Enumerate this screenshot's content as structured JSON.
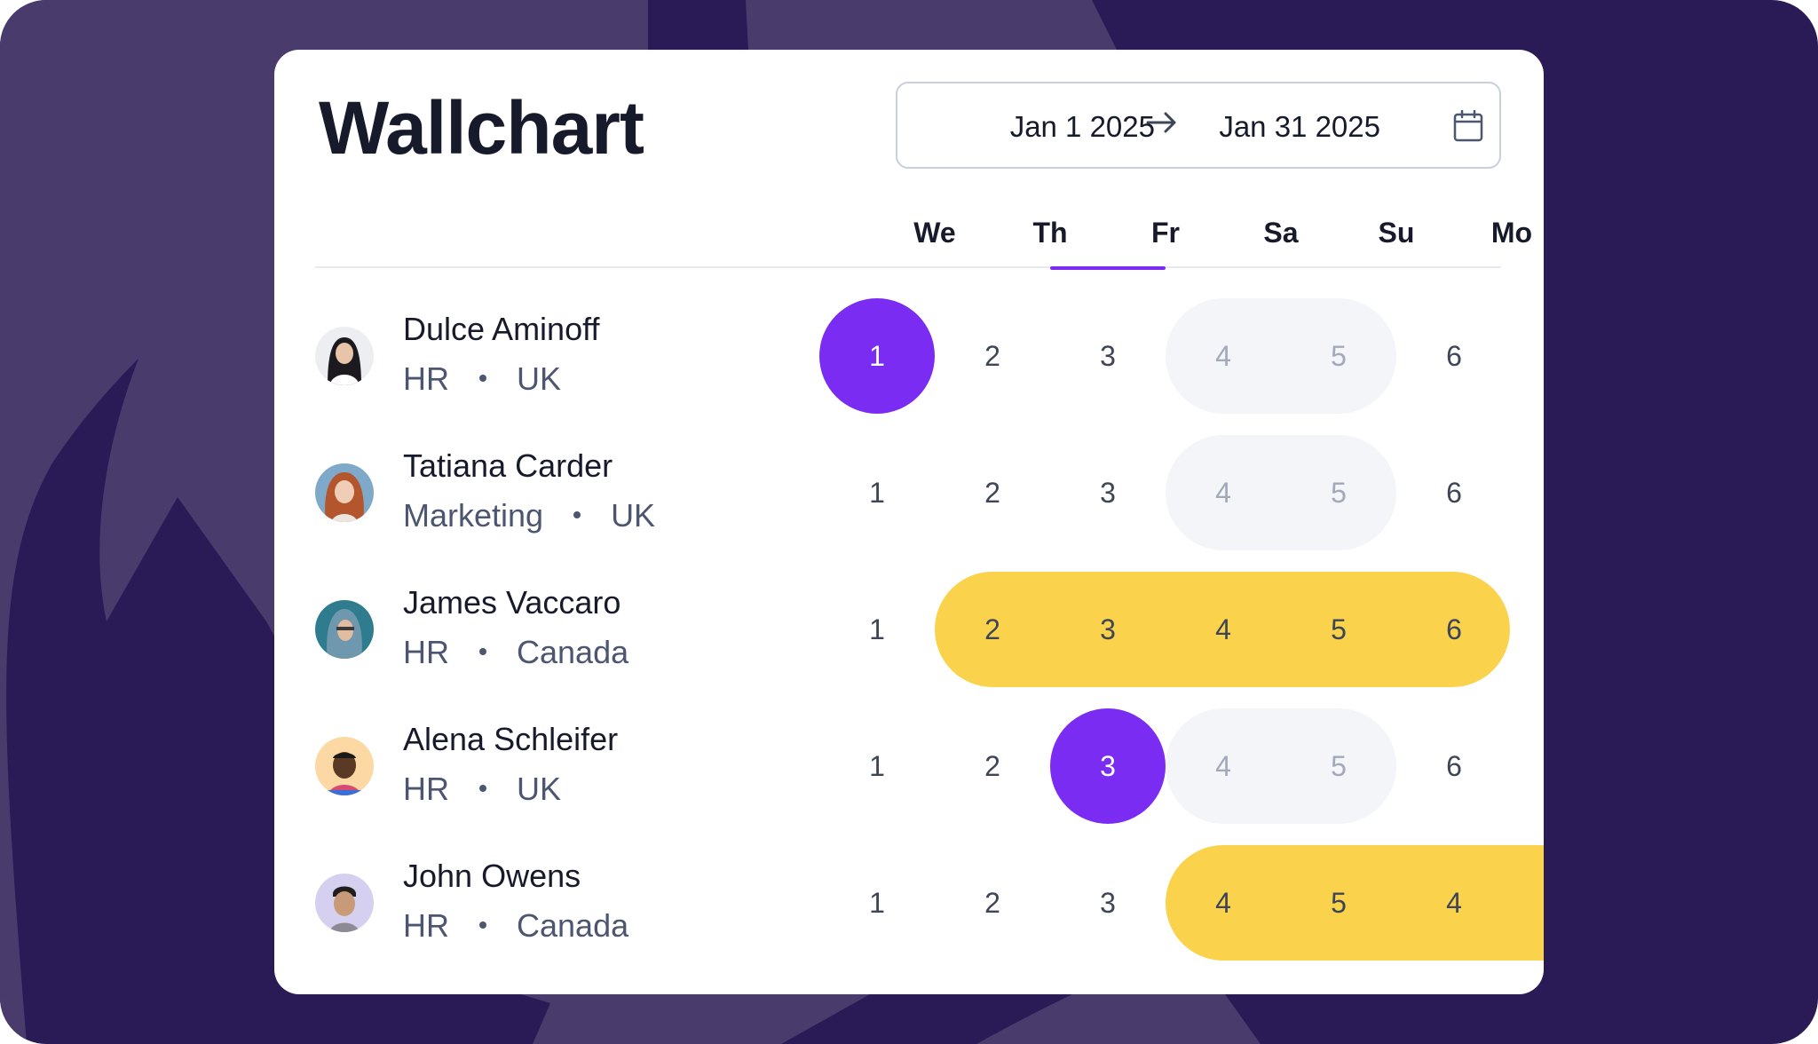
{
  "header": {
    "title": "Wallchart",
    "date_from": "Jan 1 2025",
    "date_to": "Jan 31 2025",
    "arrow_icon": "arrow-right-icon",
    "calendar_icon": "calendar-icon"
  },
  "weekdays": [
    "We",
    "Th",
    "Fr",
    "Sa",
    "Su",
    "Mo"
  ],
  "active_weekday": "Fr",
  "colors": {
    "background": "#2a1a55",
    "accent": "#7a2cf2",
    "leave": "#fad24b",
    "weekend": "#f4f5f8"
  },
  "people": [
    {
      "name": "Dulce Aminoff",
      "department": "HR",
      "country": "UK",
      "days": [
        "1",
        "2",
        "3",
        "4",
        "5",
        "6"
      ]
    },
    {
      "name": "Tatiana Carder",
      "department": "Marketing",
      "country": "UK",
      "days": [
        "1",
        "2",
        "3",
        "4",
        "5",
        "6"
      ]
    },
    {
      "name": "James Vaccaro",
      "department": "HR",
      "country": "Canada",
      "days": [
        "1",
        "2",
        "3",
        "4",
        "5",
        "6"
      ]
    },
    {
      "name": "Alena Schleifer",
      "department": "HR",
      "country": "UK",
      "days": [
        "1",
        "2",
        "3",
        "4",
        "5",
        "6"
      ]
    },
    {
      "name": "John Owens",
      "department": "HR",
      "country": "Canada",
      "days": [
        "1",
        "2",
        "3",
        "4",
        "5",
        "4"
      ]
    }
  ]
}
